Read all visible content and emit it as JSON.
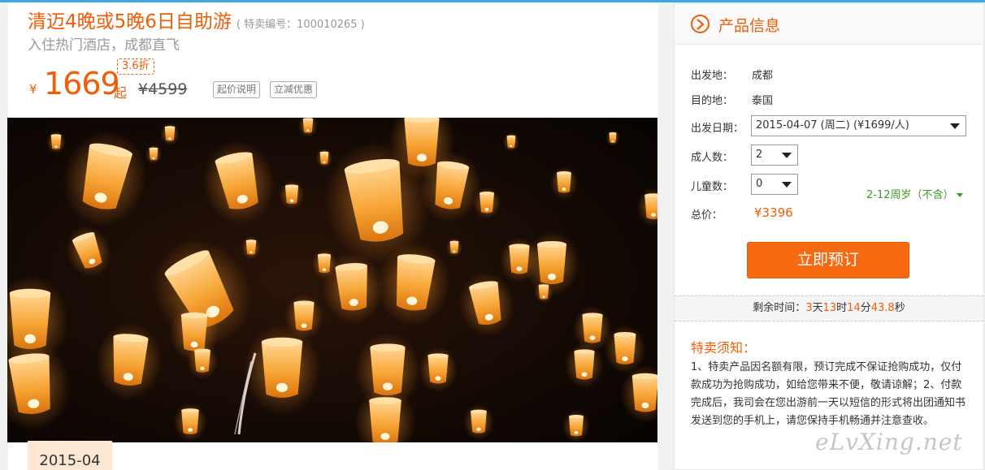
{
  "product": {
    "title": "清迈4晚或5晚6日自助游",
    "code_label": "( 特卖编号：100010265 )",
    "subtitle": "入住热门酒店，成都直飞",
    "currency": "¥",
    "price": "1669",
    "price_suffix": "起",
    "discount": "3.6折",
    "original_price": "¥4599",
    "price_note_button": "起价说明",
    "instant_discount_button": "立减优惠",
    "photo_icon": "sky-lanterns-photo",
    "date_tab": "2015-04"
  },
  "panel": {
    "title": "产品信息",
    "departure_label": "出发地：",
    "departure_value": "成都",
    "destination_label": "目的地：",
    "destination_value": "泰国",
    "date_label": "出发日期：",
    "date_value": "2015-04-07 (周二) (¥1699/人)",
    "adults_label": "成人数：",
    "adults_value": "2",
    "children_label": "儿童数：",
    "children_value": "0",
    "children_age_note": "2-12周岁（不含）",
    "total_label": "总价：",
    "total_value": "¥3396",
    "book_button": "立即预订",
    "remain": {
      "prefix": "剩余时间：",
      "days": "3",
      "day_unit": "天",
      "hours": "13",
      "hour_unit": "时",
      "minutes": "14",
      "minute_unit": "分",
      "seconds": "43.8",
      "second_unit": "秒"
    },
    "notice_title": "特卖须知：",
    "notice_text": "1、特卖产品因名额有限，预订完成不保证抢购成功，仅付款成功为抢购成功，如给您带来不便，敬请谅解；2、付款完成后，我司会在您出游前一天以短信的形式将出团通知书发送到您的手机上，请您保持手机畅通并注意查收。"
  },
  "watermark": "eLvXing.net",
  "colors": {
    "accent": "#f25c05",
    "button": "#f86a11",
    "green": "#3a9a24"
  }
}
